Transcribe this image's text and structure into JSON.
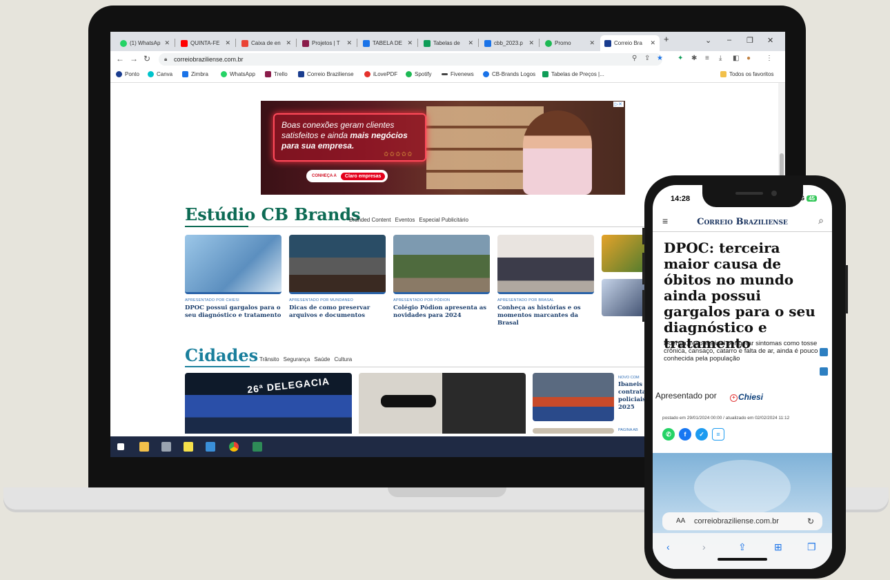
{
  "browser": {
    "tabs": [
      {
        "label": "(1) WhatsAp",
        "color": "#25d366"
      },
      {
        "label": "QUINTA-FE",
        "color": "#ff0000"
      },
      {
        "label": "Caixa de en",
        "color": "#ea4335"
      },
      {
        "label": "Projetos | T",
        "color": "#8a1c4a"
      },
      {
        "label": "TABELA DE",
        "color": "#1a73e8"
      },
      {
        "label": "Tabelas de",
        "color": "#0f9d58"
      },
      {
        "label": "cbb_2023.p",
        "color": "#1a73e8"
      },
      {
        "label": "Promo",
        "color": "#1db954"
      },
      {
        "label": "Correio Bra",
        "color": "#1a3d8f"
      }
    ],
    "new_tab": "+",
    "url": "correiobraziliense.com.br",
    "bookmarks": [
      {
        "label": "Ponto",
        "color": "#1a3d8f"
      },
      {
        "label": "Canva",
        "color": "#00c4cc"
      },
      {
        "label": "Zimbra",
        "color": "#1a73e8"
      },
      {
        "label": "WhatsApp",
        "color": "#25d366"
      },
      {
        "label": "Trello",
        "color": "#8a1c4a"
      },
      {
        "label": "Correio Braziliense",
        "color": "#1a3d8f"
      },
      {
        "label": "iLovePDF",
        "color": "#e5322d"
      },
      {
        "label": "Spotify",
        "color": "#1db954"
      },
      {
        "label": "Fivenews",
        "color": "#444444"
      },
      {
        "label": "CB-Brands Logos",
        "color": "#1a73e8"
      },
      {
        "label": "Tabelas de Preços |...",
        "color": "#0f9d58"
      }
    ],
    "all_favorites": "Todos os favoritos"
  },
  "ad": {
    "line1": "Boas conexões geram clientes",
    "line2_pre": "satisfeitos e ainda ",
    "line2_bold": "mais negócios",
    "line3": "para sua empresa.",
    "stars": "✩✩✩✩✩",
    "cta": "CONHEÇA A",
    "brand": "Claro empresas"
  },
  "cb_brands": {
    "title": "Estúdio CB Brands",
    "links": [
      "Branded Content",
      "Eventos",
      "Especial Publicitário"
    ],
    "cards": [
      {
        "kicker": "APRESENTADO POR CHIESI",
        "headline": "DPOC possui gargalos para o seu diagnóstico e tratamento"
      },
      {
        "kicker": "APRESENTADO POR MUNDANEO",
        "headline": "Dicas de como preservar arquivos e documentos"
      },
      {
        "kicker": "APRESENTADO POR PÓDION",
        "headline": "Colégio Pódion apresenta as novidades para 2024"
      },
      {
        "kicker": "APRESENTADO POR BRASAL",
        "headline": "Conheça as histórias e os momentos marcantes da Brasal"
      }
    ]
  },
  "cidades": {
    "title": "Cidades",
    "links": [
      "Trânsito",
      "Segurança",
      "Saúde",
      "Cultura"
    ],
    "sign": "26ª DELEGACIA",
    "side_kicker": "NOVO COM",
    "side_text": [
      "Ibaneis d",
      "contrata",
      "policiais",
      "2025"
    ],
    "side_kicker2": "PAGINA AB"
  },
  "phone": {
    "time": "14:28",
    "network": "5G",
    "battery": "45",
    "logo": "Correio Braziliense",
    "title": "DPOC: terceira maior causa de óbitos no mundo ainda possui gargalos para o seu diagnóstico e tratamento",
    "subtitle": "Doença, responsável por gerar sintomas como tosse crônica, cansaço, catarro e falta de ar, ainda é pouco conhecida pela população",
    "presented_by": "Apresentado por",
    "sponsor": "Chiesi",
    "date": "postado em 29/01/2024 00:00 / atualizado em 02/02/2024 11:12",
    "aa": "AA",
    "url": "correiobraziliense.com.br"
  }
}
